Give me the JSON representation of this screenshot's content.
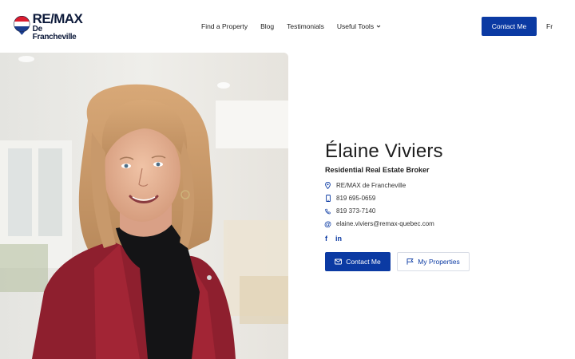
{
  "brand": {
    "logo_main": "RE/MAX",
    "logo_sub": "De Francheville",
    "colors": {
      "primary_blue": "#0b3aa3",
      "balloon_red": "#dc1c2e",
      "balloon_blue": "#1b3d8f"
    }
  },
  "nav": {
    "items": [
      {
        "label": "Find a Property"
      },
      {
        "label": "Blog"
      },
      {
        "label": "Testimonials"
      },
      {
        "label": "Useful Tools",
        "icon": "chevron-down-icon"
      }
    ],
    "contact_label": "Contact Me",
    "language_label": "Fr"
  },
  "profile": {
    "name": "Élaine Viviers",
    "role": "Residential Real Estate Broker",
    "agency": "RE/MAX de Francheville",
    "mobile": "819 695-0659",
    "phone": "819 373-7140",
    "email": "elaine.viviers@remax-quebec.com",
    "socials": [
      {
        "label": "f",
        "icon": "facebook-icon"
      },
      {
        "label": "in",
        "icon": "linkedin-icon"
      }
    ],
    "contact_button": "Contact Me",
    "properties_button": "My Properties"
  }
}
